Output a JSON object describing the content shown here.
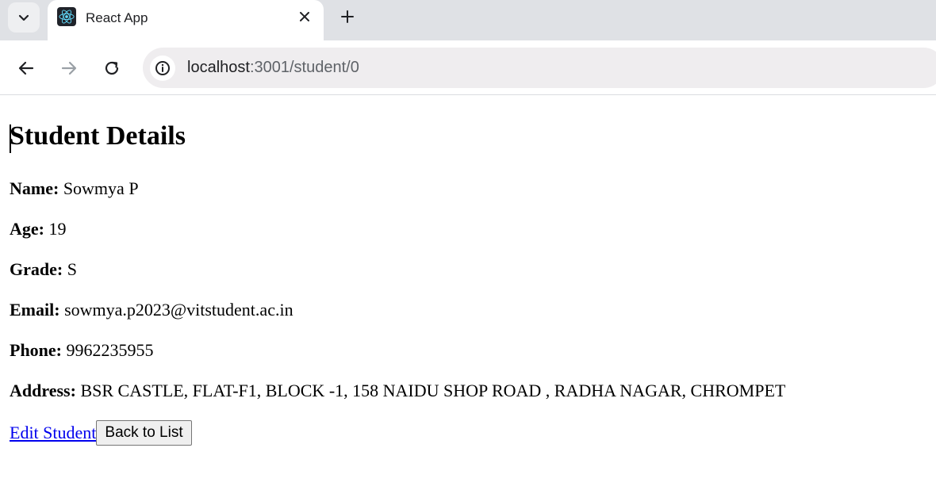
{
  "browser": {
    "tab_title": "React App",
    "url_host": "localhost",
    "url_path": ":3001/student/0",
    "icons": {
      "tab_search": "chevron-down-icon",
      "favicon": "react-logo-icon",
      "close": "close-icon",
      "new_tab": "plus-icon",
      "back": "back-arrow-icon",
      "forward": "forward-arrow-icon",
      "reload": "reload-icon",
      "site_info": "info-icon"
    }
  },
  "page": {
    "heading": "Student Details",
    "fields": {
      "name": {
        "label": "Name:",
        "value": "Sowmya P"
      },
      "age": {
        "label": "Age:",
        "value": "19"
      },
      "grade": {
        "label": "Grade:",
        "value": "S"
      },
      "email": {
        "label": "Email:",
        "value": "sowmya.p2023@vitstudent.ac.in"
      },
      "phone": {
        "label": "Phone:",
        "value": "9962235955"
      },
      "address": {
        "label": "Address:",
        "value": "BSR CASTLE, FLAT-F1, BLOCK -1, 158 NAIDU SHOP ROAD , RADHA NAGAR, CHROMPET"
      }
    },
    "edit_link_label": "Edit Student",
    "back_button_label": "Back to List"
  },
  "colors": {
    "link": "#0000ee",
    "tabstrip": "#dfe1e5",
    "omnibox": "#efedef"
  }
}
